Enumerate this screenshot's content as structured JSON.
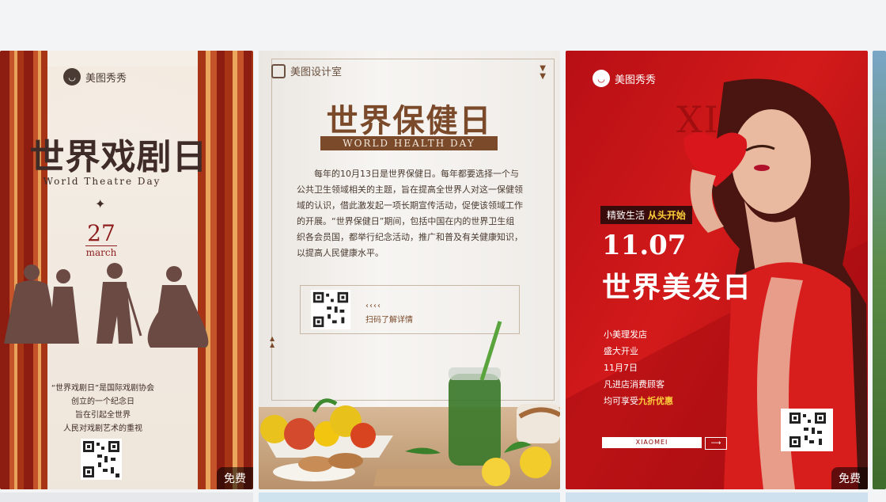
{
  "cards": [
    {
      "brand": "美图秀秀",
      "title": "世界戏剧日",
      "subtitle": "World Theatre Day",
      "day": "27",
      "month": "march",
      "note": [
        "“世界戏剧日”是国际戏剧协会",
        "创立的一个纪念日",
        "旨在引起全世界",
        "人民对戏剧艺术的重视"
      ],
      "badge": "免费"
    },
    {
      "brand": "美图设计室",
      "title": "世界保健日",
      "band": "WORLD HEALTH DAY",
      "body": "每年的10月13日是世界保健日。每年都要选择一个与公共卫生领域相关的主题，旨在提高全世界人对这一保健领域的认识，借此激发起一项长期宣传活动，促使该领域工作的开展。“世界保健日”期间，包括中国在内的世界卫生组织各会员国，都举行纪念活动，推广和普及有关健康知识，以提高人民健康水平。",
      "chevrons": "‹‹‹‹",
      "scan": "扫码了解详情"
    },
    {
      "brand": "美图秀秀",
      "bg_text": "XIAO",
      "pill_a": "精致生活",
      "pill_b": "从头开始",
      "date": "11.07",
      "title": "世界美发日",
      "info": [
        "小美理发店",
        "盛大开业",
        "11月7日",
        "凡进店消费顾客"
      ],
      "offer_a": "均可享受",
      "offer_b": "九折优惠",
      "shop": "XIAOMEI",
      "badge": "免费"
    }
  ]
}
